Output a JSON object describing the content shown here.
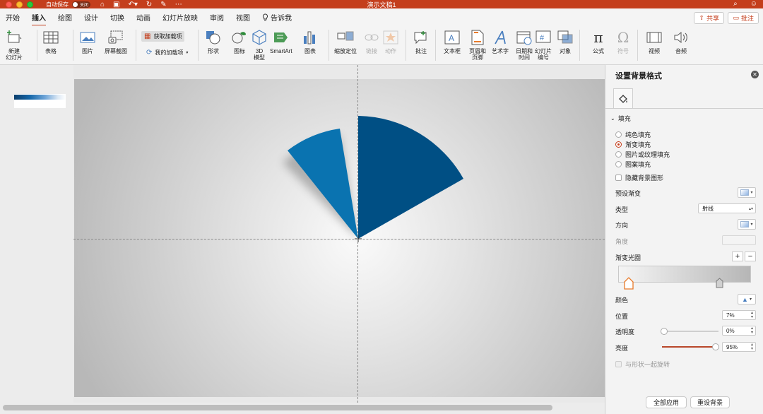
{
  "titlebar": {
    "autosave_label": "自动保存",
    "autosave_state": "关闭",
    "document_title": "演示文稿1"
  },
  "tabs": [
    "开始",
    "插入",
    "绘图",
    "设计",
    "切换",
    "动画",
    "幻灯片放映",
    "审阅",
    "视图",
    "告诉我"
  ],
  "active_tab": "插入",
  "share_label": "共享",
  "comment_label": "批注",
  "ribbon": {
    "new_slide": "新建\n幻灯片",
    "table": "表格",
    "picture": "图片",
    "screenshot": "屏幕截图",
    "get_addins": "获取加载项",
    "my_addins": "我的加载项",
    "shapes": "形状",
    "icons": "图标",
    "model3d": "3D\n模型",
    "smartart": "SmartArt",
    "chart": "图表",
    "zoom": "缩放定位",
    "link": "链接",
    "action": "动作",
    "comment": "批注",
    "textbox": "文本框",
    "header_footer": "页眉和\n页脚",
    "wordart": "艺术字",
    "datetime": "日期和\n时间",
    "slide_number": "幻灯片\n编号",
    "object": "对象",
    "equation": "公式",
    "symbol": "符号",
    "video": "视频",
    "audio": "音频"
  },
  "pane": {
    "title": "设置背景格式",
    "section": "填充",
    "fill_options": [
      "纯色填充",
      "渐变填充",
      "图片或纹理填充",
      "图案填充"
    ],
    "selected_fill": "渐变填充",
    "hide_bg_graphics": "隐藏背景图形",
    "preset_gradient": "预设渐变",
    "type_label": "类型",
    "type_value": "射线",
    "direction_label": "方向",
    "angle_label": "角度",
    "stops_label": "渐变光圈",
    "color_label": "颜色",
    "position_label": "位置",
    "position_value": "7%",
    "transparency_label": "透明度",
    "transparency_value": "0%",
    "transparency_level": 0,
    "brightness_label": "亮度",
    "brightness_value": "95%",
    "brightness_level": 0.95,
    "rotate_with_shape": "与形状一起旋转",
    "apply_all": "全部应用",
    "reset_bg": "重设背景"
  },
  "colors": {
    "accent": "#c43e1c",
    "sector_dark": "#004f84",
    "sector_light": "#0a73b0"
  },
  "icons": [
    "home-icon",
    "save-icon",
    "undo-icon",
    "redo-icon",
    "format-icon",
    "more-icon",
    "search-icon",
    "profile-icon"
  ]
}
